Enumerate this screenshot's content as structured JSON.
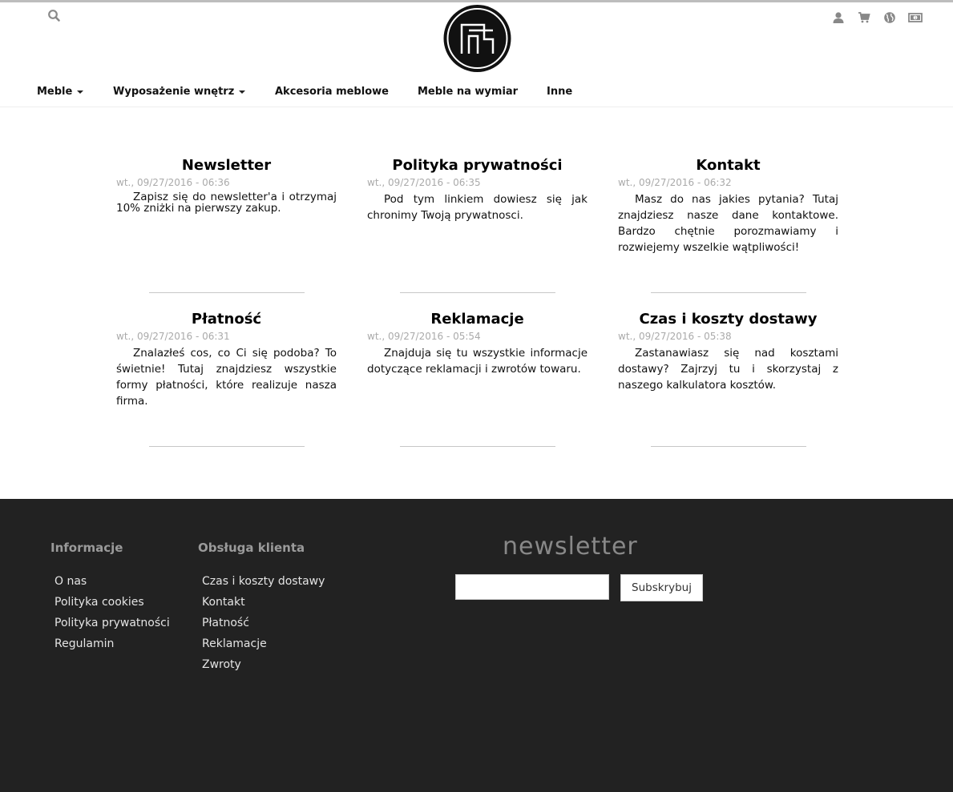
{
  "header": {
    "search_icon": "search-icon",
    "logo_icon": "logo-icon",
    "icons": [
      "user-icon",
      "cart-icon",
      "globe-icon",
      "money-icon"
    ]
  },
  "nav": {
    "items": [
      {
        "label": "Meble",
        "dropdown": true
      },
      {
        "label": "Wyposażenie wnętrz",
        "dropdown": true
      },
      {
        "label": "Akcesoria meblowe",
        "dropdown": false
      },
      {
        "label": "Meble na wymiar",
        "dropdown": false
      },
      {
        "label": "Inne",
        "dropdown": false
      }
    ]
  },
  "articles": [
    {
      "title": "Newsletter",
      "date": "wt., 09/27/2016 - 06:36",
      "body": "Zapisz się do newsletter'a i otrzymaj 10% zniżki na pierwszy zakup."
    },
    {
      "title": "Polityka prywatności",
      "date": "wt., 09/27/2016 - 06:35",
      "body": "Pod tym linkiem dowiesz się jak chronimy Twoją prywatnosci."
    },
    {
      "title": "Kontakt",
      "date": "wt., 09/27/2016 - 06:32",
      "body": "Masz do nas jakies pytania? Tutaj znajdziesz nasze dane kontaktowe. Bardzo chętnie porozmawiamy i rozwiejemy wszelkie wątpliwości!"
    },
    {
      "title": "Płatność",
      "date": "wt., 09/27/2016 - 06:31",
      "body": "Znalazłeś cos, co Ci się podoba? To świetnie!  Tutaj znajdziesz wszystkie formy płatności,  które realizuje nasza firma."
    },
    {
      "title": "Reklamacje",
      "date": "wt., 09/27/2016 - 05:54",
      "body": "Znajduja się tu wszystkie informacje dotyczące reklamacji i zwrotów towaru."
    },
    {
      "title": "Czas i koszty dostawy",
      "date": "wt., 09/27/2016 - 05:38",
      "body": "Zastanawiasz się nad kosztami dostawy? Zajrzyj tu i skorzystaj z naszego kalkulatora kosztów."
    }
  ],
  "footer": {
    "info": {
      "heading": "Informacje",
      "links": [
        "O nas",
        "Polityka cookies",
        "Polityka prywatności",
        "Regulamin"
      ]
    },
    "service": {
      "heading": "Obsługa klienta",
      "links": [
        "Czas i koszty dostawy",
        "Kontakt",
        "Płatność",
        "Reklamacje",
        "Zwroty"
      ]
    },
    "newsletter": {
      "heading": "newsletter",
      "input_value": "",
      "button_label": "Subskrybuj"
    }
  },
  "colors": {
    "footer_bg": "#222222",
    "footer_heading": "#9a9a9a",
    "footer_link": "#e4e4e4",
    "date_gray": "#aaaaaa"
  }
}
